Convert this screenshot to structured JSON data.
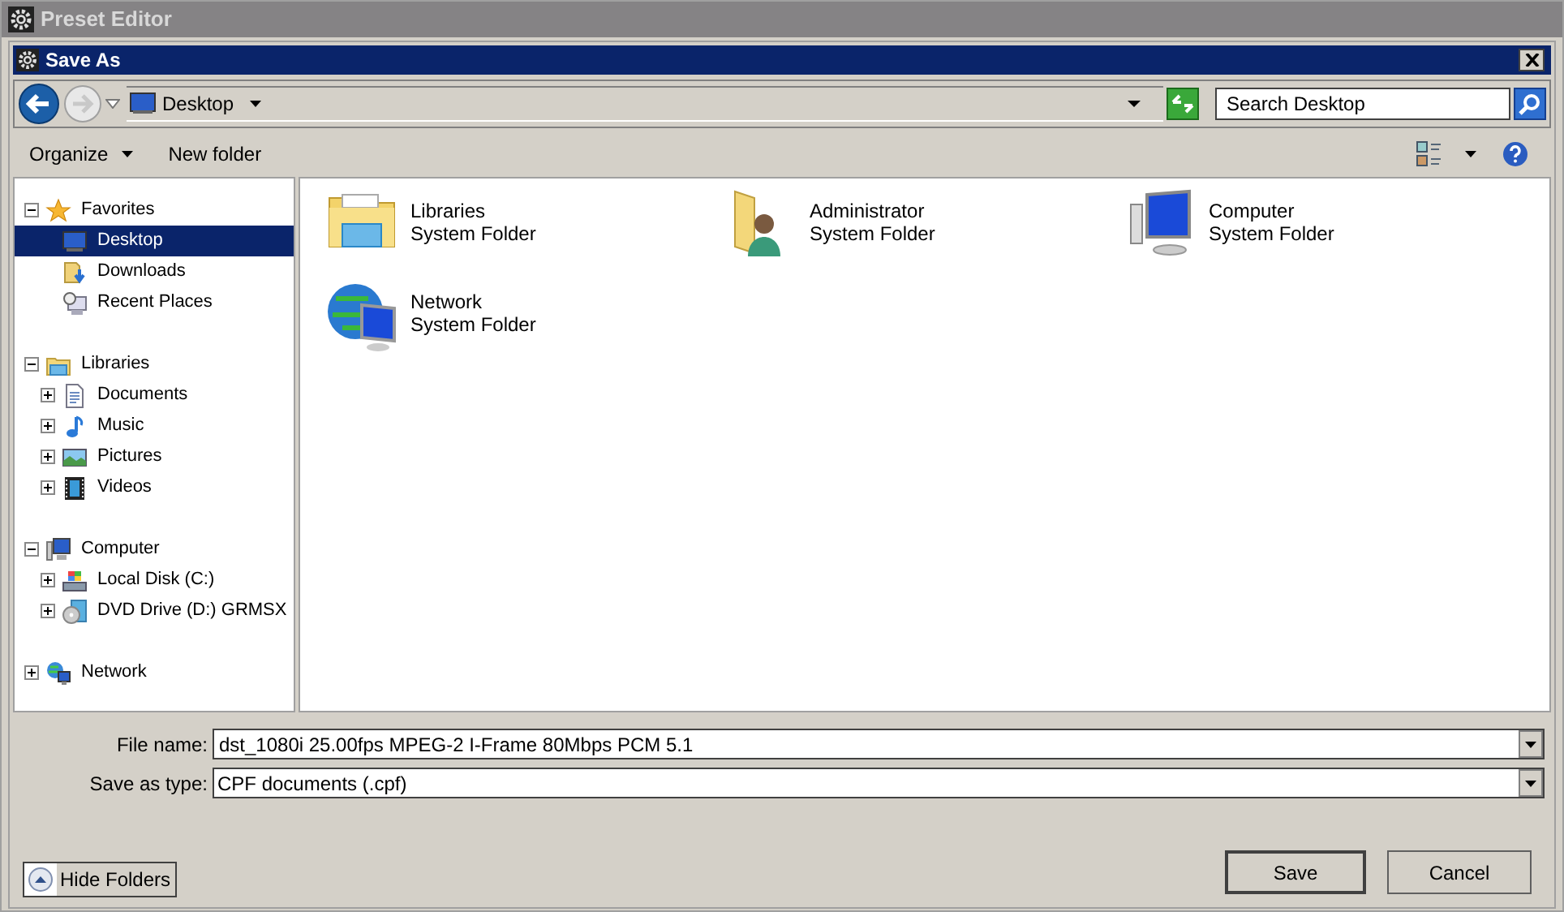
{
  "app_window": {
    "title": "Preset Editor"
  },
  "dialog": {
    "title": "Save As"
  },
  "address_bar": {
    "location": "Desktop",
    "search": {
      "placeholder": "Search Desktop"
    }
  },
  "toolbar": {
    "organize": "Organize",
    "new_folder": "New folder"
  },
  "navigation_tree": [
    {
      "label": "Favorites",
      "expanded": true,
      "selected": false,
      "children": [
        {
          "label": "Desktop",
          "selected": true
        },
        {
          "label": "Downloads",
          "selected": false
        },
        {
          "label": "Recent Places",
          "selected": false
        }
      ]
    },
    {
      "label": "Libraries",
      "expanded": true,
      "selected": false,
      "children": [
        {
          "label": "Documents",
          "expanded": false,
          "selected": false
        },
        {
          "label": "Music",
          "expanded": false,
          "selected": false
        },
        {
          "label": "Pictures",
          "expanded": false,
          "selected": false
        },
        {
          "label": "Videos",
          "expanded": false,
          "selected": false
        }
      ]
    },
    {
      "label": "Computer",
      "expanded": true,
      "selected": false,
      "children": [
        {
          "label": "Local Disk (C:)",
          "expanded": false,
          "selected": false
        },
        {
          "label": "DVD Drive (D:) GRMSX",
          "expanded": false,
          "selected": false
        }
      ]
    },
    {
      "label": "Network",
      "expanded": false,
      "selected": false
    }
  ],
  "items": [
    {
      "name": "Libraries",
      "type": "System Folder"
    },
    {
      "name": "Administrator",
      "type": "System Folder"
    },
    {
      "name": "Computer",
      "type": "System Folder"
    },
    {
      "name": "Network",
      "type": "System Folder"
    }
  ],
  "file_name": {
    "label": "File name:",
    "value": "dst_1080i 25.00fps MPEG-2 I-Frame 80Mbps PCM 5.1"
  },
  "save_as_type": {
    "label": "Save as type:",
    "value": "CPF documents (.cpf)"
  },
  "hide_folders": "Hide Folders",
  "buttons": [
    "Save",
    "Cancel"
  ]
}
